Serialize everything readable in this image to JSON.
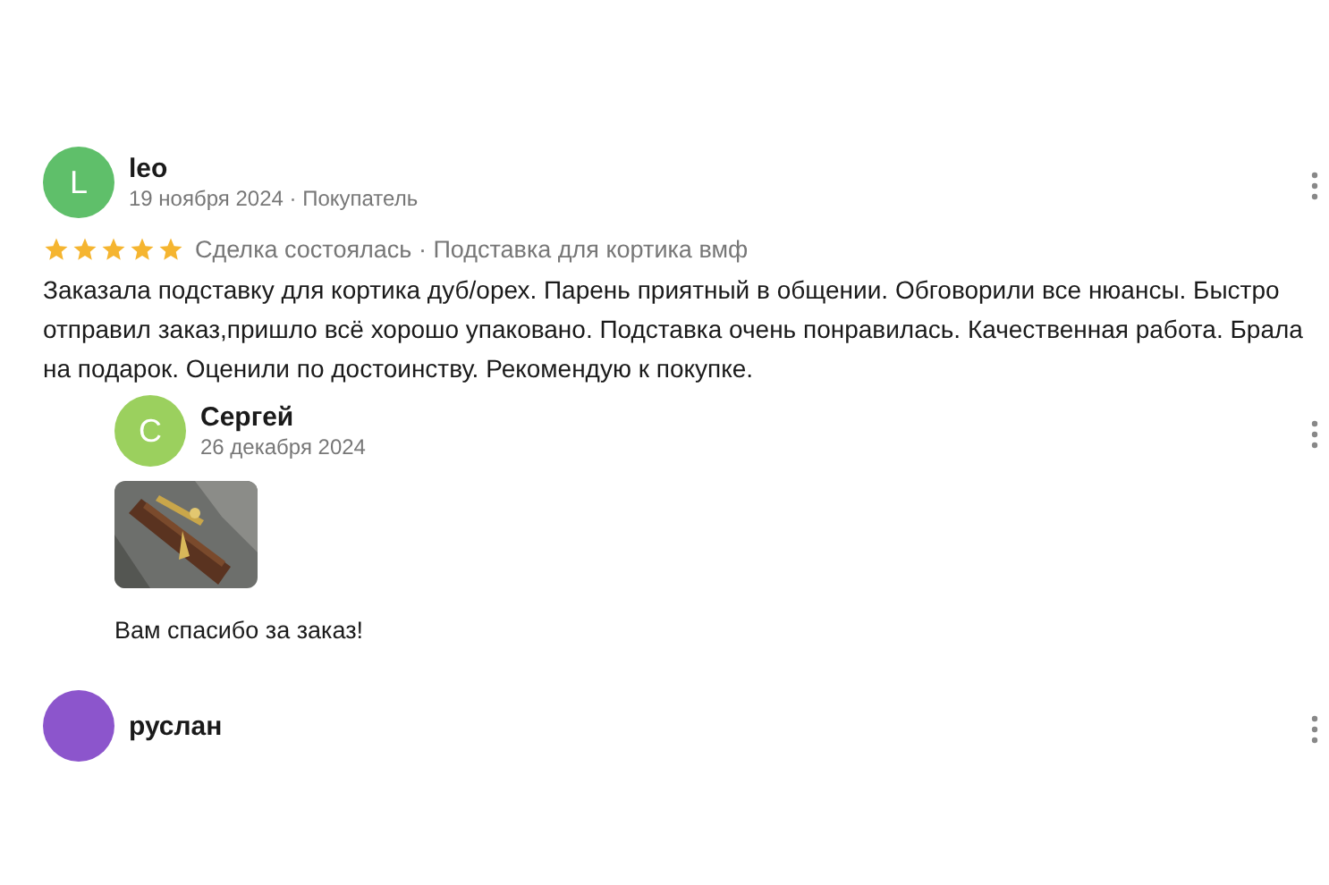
{
  "reviews": [
    {
      "avatar_letter": "L",
      "color": "#5fbf6a",
      "author": "leo",
      "date": "19 ноября 2024 · Покупатель",
      "stars": 5,
      "meta": "Сделка состоялась · Подставка для кортика вмф",
      "text": "Заказала подставку для кортика дуб/орех. Парень приятный в общении. Обговорили все нюансы. Быстро отправил заказ,пришло всё хорошо упаковано. Подставка очень понравилась. Качественная работа. Брала на подарок. Оценили по достоинству. Рекомендую к покупке.",
      "reply": {
        "avatar_letter": "С",
        "color": "#9bd05e",
        "author": "Сергей",
        "date": "26 декабря 2024",
        "text": "Вам спасибо за заказ!"
      }
    },
    {
      "color": "#8c55cc",
      "author": "руслан"
    }
  ]
}
